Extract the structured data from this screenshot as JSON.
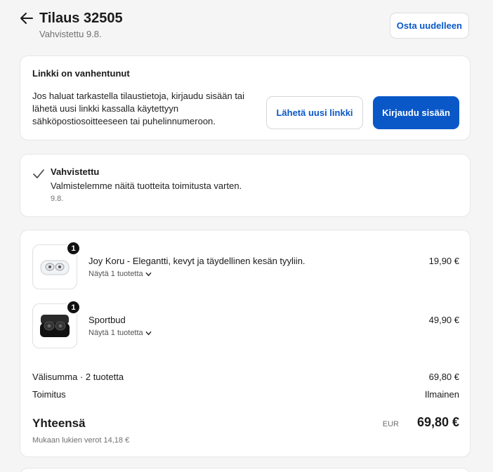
{
  "header": {
    "title": "Tilaus 32505",
    "subtitle": "Vahvistettu 9.8.",
    "buy_again": "Osta uudelleen"
  },
  "link_card": {
    "title": "Linkki on vanhentunut",
    "body": "Jos haluat tarkastella tilaustietoja, kirjaudu sisään tai lähetä uusi linkki kassalla käytettyyn sähköpostiosoitteeseen tai puhelinnumeroon.",
    "send_button": "Lähetä uusi linkki",
    "login_button": "Kirjaudu sisään"
  },
  "status_card": {
    "title": "Vahvistettu",
    "description": "Valmistelemme näitä tuotteita toimitusta varten.",
    "date": "9.8."
  },
  "products": [
    {
      "name": "Joy Koru - Elegantti, kevyt ja täydellinen kesän tyyliin.",
      "quantity": "1",
      "show_label": "Näytä 1 tuotetta",
      "price": "19,90 €",
      "icon": "earbuds-case-white"
    },
    {
      "name": "Sportbud",
      "quantity": "1",
      "show_label": "Näytä 1 tuotetta",
      "price": "49,90 €",
      "icon": "earbuds-case-black"
    }
  ],
  "summary": {
    "subtotal_label": "Välisumma · 2 tuotetta",
    "subtotal_value": "69,80 €",
    "shipping_label": "Toimitus",
    "shipping_value": "Ilmainen",
    "total_label": "Yhteensä",
    "currency": "EUR",
    "total_value": "69,80 €",
    "tax_note": "Mukaan lukien verot 14,18 €"
  },
  "colors": {
    "accent": "#0a58c8",
    "background": "#f5f5f5"
  }
}
